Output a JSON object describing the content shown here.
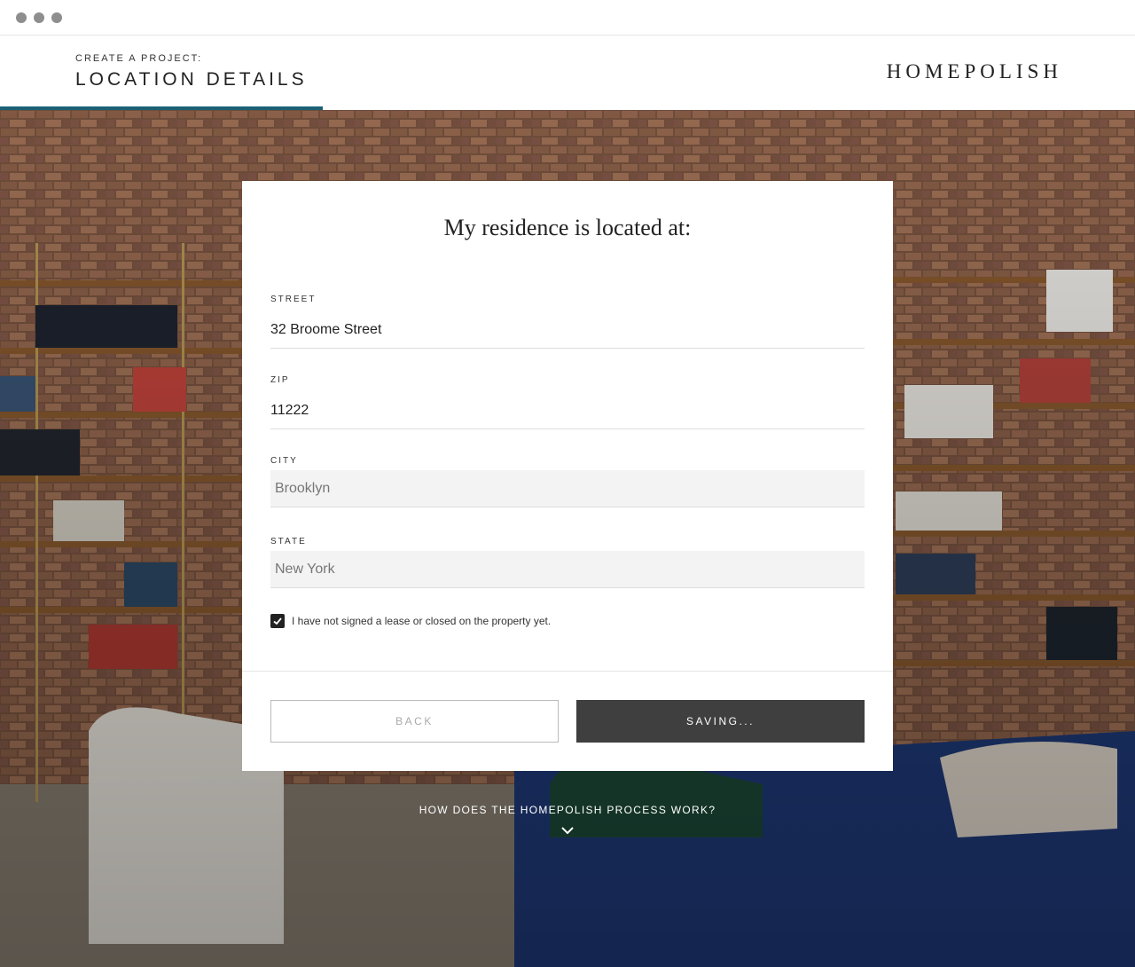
{
  "window": {
    "controls": [
      "close",
      "minimize",
      "maximize"
    ]
  },
  "header": {
    "eyebrow": "CREATE A PROJECT:",
    "title": "LOCATION DETAILS",
    "logo": "HOMEPOLISH",
    "progress_fraction": 0.284,
    "accent_color": "#1b6175"
  },
  "form": {
    "title": "My residence is located at:",
    "street": {
      "label": "STREET",
      "value": "32 Broome Street"
    },
    "zip": {
      "label": "ZIP",
      "value": "11222"
    },
    "city": {
      "label": "CITY",
      "value": "Brooklyn"
    },
    "state": {
      "label": "STATE",
      "value": "New York"
    },
    "no_lease": {
      "label": "I have not signed a lease or closed on the property yet.",
      "checked": true
    },
    "back_label": "BACK",
    "save_label": "SAVING..."
  },
  "footer": {
    "how_label": "HOW DOES THE HOMEPOLISH PROCESS WORK?",
    "chevron_icon": "chevron-down-icon"
  },
  "background": {
    "description_icon": "living-room-photo"
  }
}
